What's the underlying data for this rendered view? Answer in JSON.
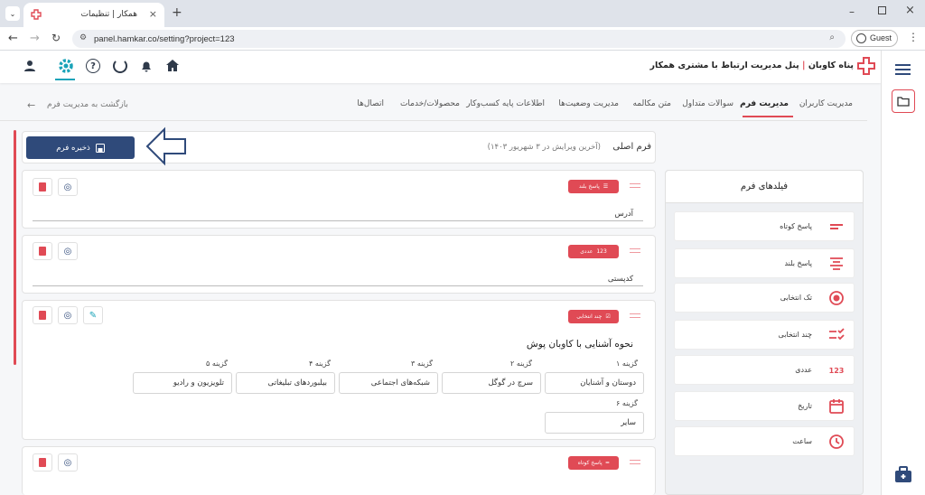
{
  "browser": {
    "tab_title": "همکار | تنظیمات",
    "url": "panel.hamkar.co/setting?project=123",
    "guest_label": "Guest"
  },
  "header": {
    "brand_name": "پناه کاوبان",
    "brand_subtitle": "پنل مدیریت ارتباط با مشتری همکار"
  },
  "nav": {
    "back_label": "بازگشت به مدیریت فرم",
    "items": [
      "مدیریت کاربران",
      "مدیریت فرم",
      "سوالات متداول",
      "متن مکالمه",
      "مدیریت وضعیت‌ها",
      "اطلاعات پایه کسب‌وکار",
      "محصولات/خدمات",
      "اتصال‌ها"
    ],
    "active": "مدیریت فرم"
  },
  "form": {
    "title": "فرم اصلی",
    "last_edit": "(آخرین ویرایش در ۳ شهریور ۱۴۰۳)",
    "save_label": "ذخیره فرم",
    "items": [
      {
        "badge": "پاسخ بلند",
        "label": "آدرس"
      },
      {
        "badge": "عددی",
        "label": "کدپستی"
      },
      {
        "badge": "چند انتخابی",
        "question": "نحوه آشنایی با کاوبان پوش",
        "options": [
          {
            "label": "گزینه ۱",
            "value": "دوستان و آشنایان"
          },
          {
            "label": "گزینه ۲",
            "value": "سرچ در گوگل"
          },
          {
            "label": "گزینه ۳",
            "value": "شبکه‌های اجتماعی"
          },
          {
            "label": "گزینه ۴",
            "value": "بیلبوردهای تبلیغاتی"
          },
          {
            "label": "گزینه ۵",
            "value": "تلویزیون و رادیو"
          },
          {
            "label": "گزینه ۶",
            "value": "سایر"
          }
        ]
      },
      {
        "badge": "پاسخ کوتاه"
      }
    ]
  },
  "fields_panel": {
    "title": "فیلدهای فرم",
    "items": [
      {
        "label": "پاسخ کوتاه",
        "icon": "short-answer-icon"
      },
      {
        "label": "پاسخ بلند",
        "icon": "long-answer-icon"
      },
      {
        "label": "تک انتخابی",
        "icon": "radio-icon"
      },
      {
        "label": "چند انتخابی",
        "icon": "checklist-icon"
      },
      {
        "label": "عددی",
        "icon": "number-icon"
      },
      {
        "label": "تاریخ",
        "icon": "calendar-icon"
      },
      {
        "label": "ساعت",
        "icon": "clock-icon"
      }
    ]
  },
  "number_icon_text": "123",
  "colors": {
    "accent": "#e04a55",
    "primary": "#2f4a7a",
    "active_teal": "#1aa3b8"
  }
}
